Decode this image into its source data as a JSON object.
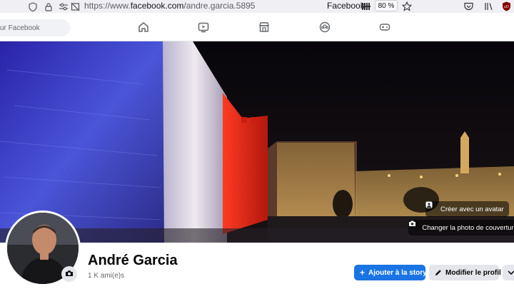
{
  "browser": {
    "url_prefix": "https://www.",
    "url_domain": "facebook.com",
    "url_path": "/andre.garcia.5895",
    "reader_label": "Facebook",
    "zoom": "80 %"
  },
  "nav": {
    "search_placeholder": "ur Facebook"
  },
  "cover": {
    "avatar_button": "Créer avec un avatar",
    "change_cover_button": "Changer la photo de couverture"
  },
  "profile": {
    "name": "André Garcia",
    "friends": "1 K ami(e)s"
  },
  "actions": {
    "add_story": "Ajouter à la story",
    "edit_profile": "Modifier le profil"
  }
}
